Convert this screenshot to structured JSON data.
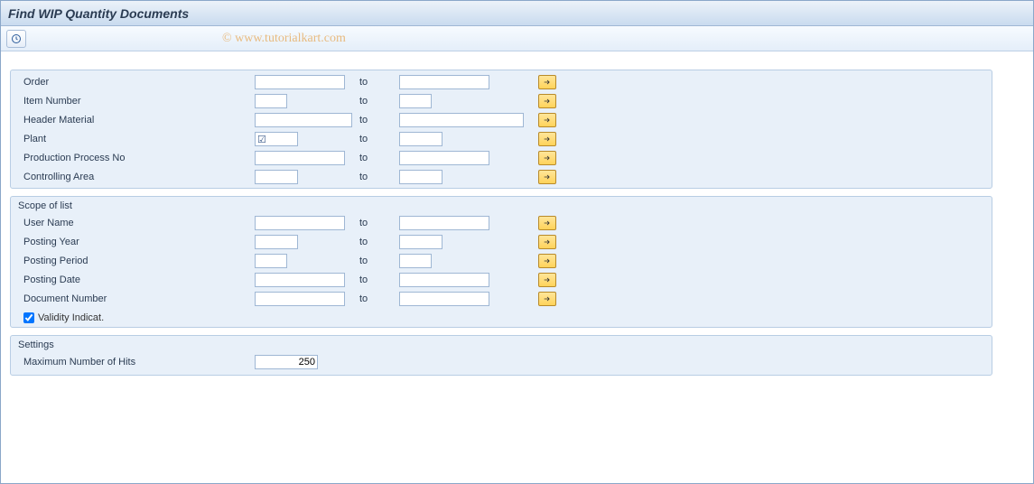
{
  "title": "Find WIP Quantity Documents",
  "watermark": "© www.tutorialkart.com",
  "toText": "to",
  "topFields": [
    {
      "label": "Order",
      "fromW": "w-lg",
      "toW": "w-lg",
      "plantCheck": false
    },
    {
      "label": "Item Number",
      "fromW": "w-sm",
      "toW": "w-sm",
      "plantCheck": false
    },
    {
      "label": "Header Material",
      "fromW": "w-lg",
      "toW": "w-lg",
      "wide": true,
      "plantCheck": false
    },
    {
      "label": "Plant",
      "fromW": "w-med",
      "toW": "w-med",
      "plantCheck": true
    },
    {
      "label": "Production Process No",
      "fromW": "w-lg",
      "toW": "w-lg",
      "plantCheck": false
    },
    {
      "label": "Controlling Area",
      "fromW": "w-med",
      "toW": "w-med",
      "plantCheck": false
    }
  ],
  "scope": {
    "legend": "Scope of list",
    "fields": [
      {
        "label": "User Name",
        "fromW": "w-lg",
        "toW": "w-lg"
      },
      {
        "label": "Posting Year",
        "fromW": "w-med",
        "toW": "w-med"
      },
      {
        "label": "Posting Period",
        "fromW": "w-sm",
        "toW": "w-sm"
      },
      {
        "label": "Posting Date",
        "fromW": "w-lg",
        "toW": "w-lg"
      },
      {
        "label": "Document Number",
        "fromW": "w-lg",
        "toW": "w-lg"
      }
    ],
    "validityLabel": "Validity Indicat.",
    "validityChecked": true
  },
  "settings": {
    "legend": "Settings",
    "maxHitsLabel": "Maximum Number of Hits",
    "maxHits": "250"
  }
}
